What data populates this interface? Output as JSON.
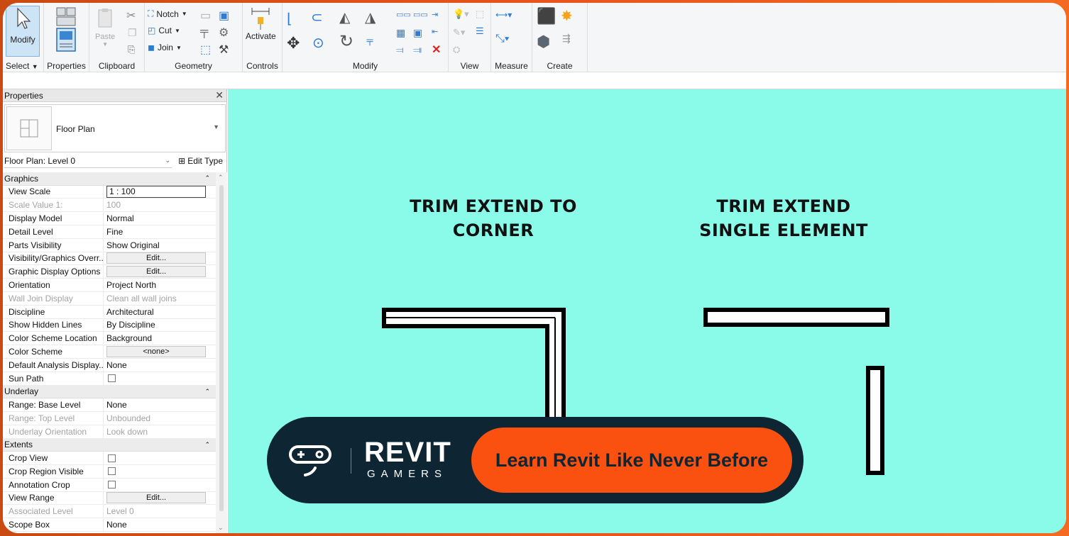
{
  "ribbon": {
    "modify_label": "Modify",
    "select_label": "Select",
    "properties_label": "Properties",
    "clipboard_label": "Clipboard",
    "paste_label": "Paste",
    "geometry_label": "Geometry",
    "notch_label": "Notch",
    "cut_label": "Cut",
    "join_label": "Join",
    "controls_label": "Controls",
    "activate_label": "Activate",
    "modify_panel_label": "Modify",
    "view_label": "View",
    "measure_label": "Measure",
    "create_label": "Create"
  },
  "properties": {
    "title": "Properties",
    "type_name": "Floor Plan",
    "instance": "Floor Plan: Level 0",
    "edit_type": "Edit Type",
    "groups": [
      {
        "name": "Graphics",
        "rows": [
          {
            "name": "View Scale",
            "value": "1 : 100",
            "kind": "field"
          },
          {
            "name": "Scale Value    1:",
            "value": "100",
            "kind": "text",
            "dim": true
          },
          {
            "name": "Display Model",
            "value": "Normal",
            "kind": "text"
          },
          {
            "name": "Detail Level",
            "value": "Fine",
            "kind": "text"
          },
          {
            "name": "Parts Visibility",
            "value": "Show Original",
            "kind": "text"
          },
          {
            "name": "Visibility/Graphics Overr...",
            "value": "Edit...",
            "kind": "button"
          },
          {
            "name": "Graphic Display Options",
            "value": "Edit...",
            "kind": "button"
          },
          {
            "name": "Orientation",
            "value": "Project North",
            "kind": "text"
          },
          {
            "name": "Wall Join Display",
            "value": "Clean all wall joins",
            "kind": "text",
            "dim": true
          },
          {
            "name": "Discipline",
            "value": "Architectural",
            "kind": "text"
          },
          {
            "name": "Show Hidden Lines",
            "value": "By Discipline",
            "kind": "text"
          },
          {
            "name": "Color Scheme Location",
            "value": "Background",
            "kind": "text"
          },
          {
            "name": "Color Scheme",
            "value": "<none>",
            "kind": "button"
          },
          {
            "name": "Default Analysis Display...",
            "value": "None",
            "kind": "text"
          },
          {
            "name": "Sun Path",
            "value": "",
            "kind": "check"
          }
        ]
      },
      {
        "name": "Underlay",
        "rows": [
          {
            "name": "Range: Base Level",
            "value": "None",
            "kind": "text"
          },
          {
            "name": "Range: Top Level",
            "value": "Unbounded",
            "kind": "text",
            "dim": true
          },
          {
            "name": "Underlay Orientation",
            "value": "Look down",
            "kind": "text",
            "dim": true
          }
        ]
      },
      {
        "name": "Extents",
        "rows": [
          {
            "name": "Crop View",
            "value": "",
            "kind": "check"
          },
          {
            "name": "Crop Region Visible",
            "value": "",
            "kind": "check"
          },
          {
            "name": "Annotation Crop",
            "value": "",
            "kind": "check"
          },
          {
            "name": "View Range",
            "value": "Edit...",
            "kind": "button"
          },
          {
            "name": "Associated Level",
            "value": "Level 0",
            "kind": "text",
            "dim": true
          },
          {
            "name": "Scope Box",
            "value": "None",
            "kind": "text"
          }
        ]
      }
    ]
  },
  "canvas": {
    "heading_left_1": "TRIM EXTEND TO",
    "heading_left_2": "CORNER",
    "heading_right_1": "TRIM EXTEND",
    "heading_right_2": "SINGLE ELEMENT",
    "background": "#8bfbe9"
  },
  "banner": {
    "brand": "REVIT",
    "brand_sub": "GAMERS",
    "cta": "Learn Revit Like Never Before",
    "accent": "#fa5010",
    "dark": "#0e2633"
  }
}
